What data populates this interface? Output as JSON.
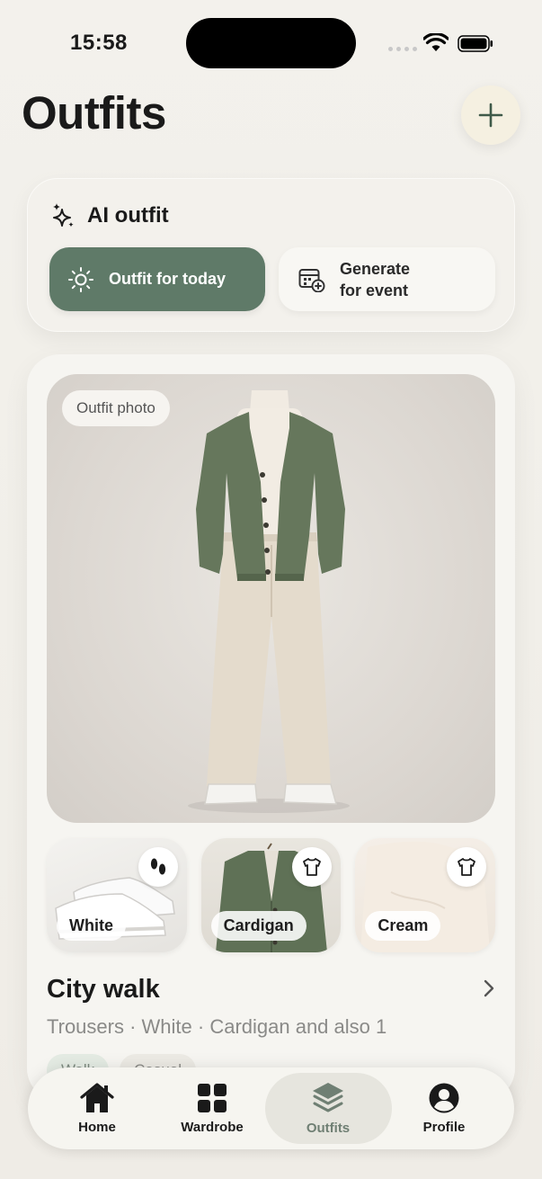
{
  "status": {
    "time": "15:58"
  },
  "header": {
    "title": "Outfits"
  },
  "ai": {
    "title": "AI outfit",
    "today_label": "Outfit for today",
    "event_line1": "Generate",
    "event_line2": "for event"
  },
  "outfit": {
    "photo_label": "Outfit photo",
    "items": [
      {
        "label": "White",
        "icon": "shoes-icon"
      },
      {
        "label": "Cardigan",
        "icon": "shirt-icon"
      },
      {
        "label": "Cream",
        "icon": "shirt-icon"
      }
    ],
    "name": "City walk",
    "description": "Trousers · White · Cardigan and also 1",
    "tags": [
      "Walk",
      "Casual"
    ]
  },
  "tabs": [
    {
      "label": "Home",
      "icon": "home-icon"
    },
    {
      "label": "Wardrobe",
      "icon": "grid-icon"
    },
    {
      "label": "Outfits",
      "icon": "layers-icon"
    },
    {
      "label": "Profile",
      "icon": "profile-icon"
    }
  ],
  "colors": {
    "accent": "#5f7a68",
    "background": "#f3f1ec",
    "active_tab": "#6f7f73"
  }
}
